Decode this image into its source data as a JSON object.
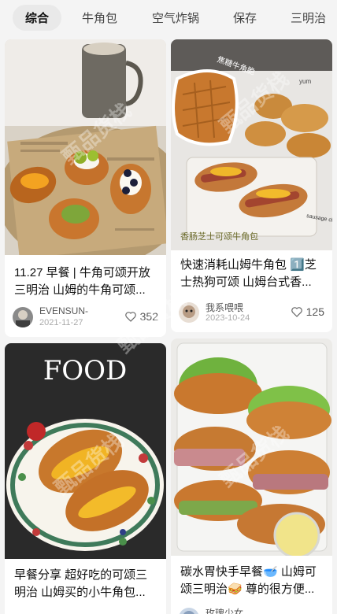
{
  "tabs": [
    "综合",
    "牛角包",
    "空气炸锅",
    "保存",
    "三明治"
  ],
  "cards": [
    {
      "title": "11.27 早餐 | 牛角可颂开放三明治 山姆的牛角可颂...",
      "author": "EVENSUN-",
      "date": "2021-11-27",
      "likes": "352"
    },
    {
      "title": "快速消耗山姆牛角包 1️⃣芝士热狗可颂 山姆台式香...",
      "author": "我系喂喂",
      "date": "2023-10-24",
      "likes": "125",
      "image_text_1": "焦糖牛角脆",
      "image_text_2": "yum",
      "image_text_3": "香肠芝士可颂牛角包",
      "image_text_4": "sausage cheese fries"
    },
    {
      "title": "早餐分享 超好吃的可颂三明治 山姆买的小牛角包...",
      "image_text": "FOOD"
    },
    {
      "title": "碳水胃快手早餐🥣 山姆可颂三明治🥪 尊的很方便...",
      "author": "玫瑰少女"
    }
  ],
  "watermark": "甄品货栈",
  "icons": {
    "like": "heart-outline-icon"
  },
  "colors": {
    "background": "#f4f4f4",
    "active_tab_bg": "#e9e9e9",
    "card": "#ffffff"
  }
}
